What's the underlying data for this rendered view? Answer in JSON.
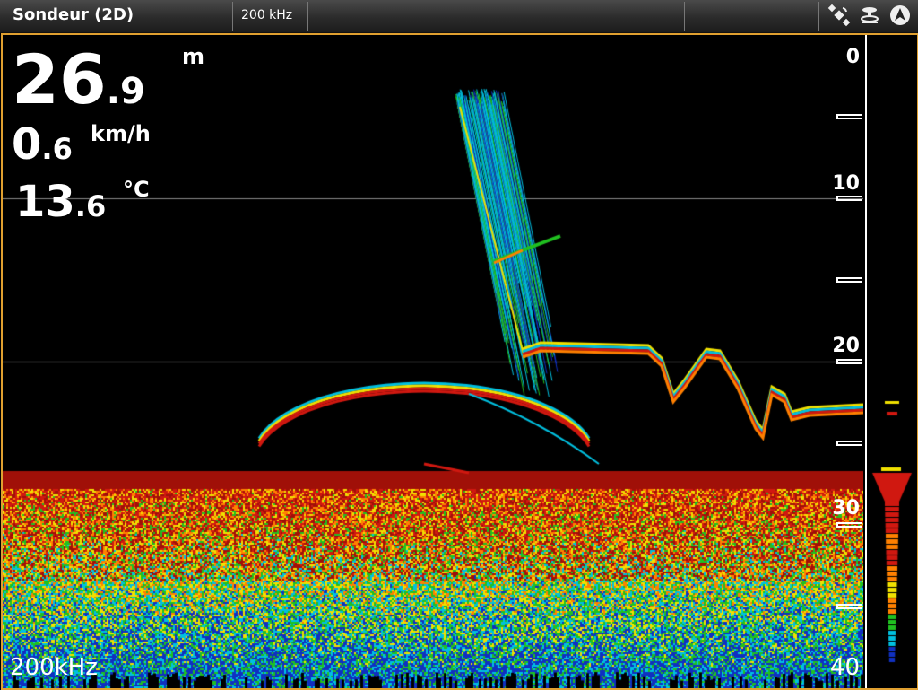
{
  "topbar": {
    "title": "Sondeur (2D)",
    "frequency_tab": "200 kHz",
    "icons": [
      "satellite-icon",
      "sonar-icon",
      "navigation-icon"
    ]
  },
  "readouts": {
    "depth": {
      "int": "26",
      "dec": ".9",
      "unit": "m"
    },
    "speed": {
      "int": "0",
      "dec": ".6",
      "unit": "km/h"
    },
    "temperature": {
      "int": "13",
      "dec": ".6",
      "unit": "°C"
    }
  },
  "sonar": {
    "frequency_label": "200kHz",
    "depth_scale": {
      "labels": [
        "0",
        "10",
        "20",
        "30",
        "40"
      ],
      "max": 40
    },
    "colors": {
      "bottom_strong": "#a01008",
      "bottom_red": "#d01810",
      "orange": "#ff8000",
      "yellow": "#f0e000",
      "green": "#20c020",
      "cyan": "#00c0e0",
      "blue": "#1030c0",
      "frame": "#e0a030"
    }
  }
}
